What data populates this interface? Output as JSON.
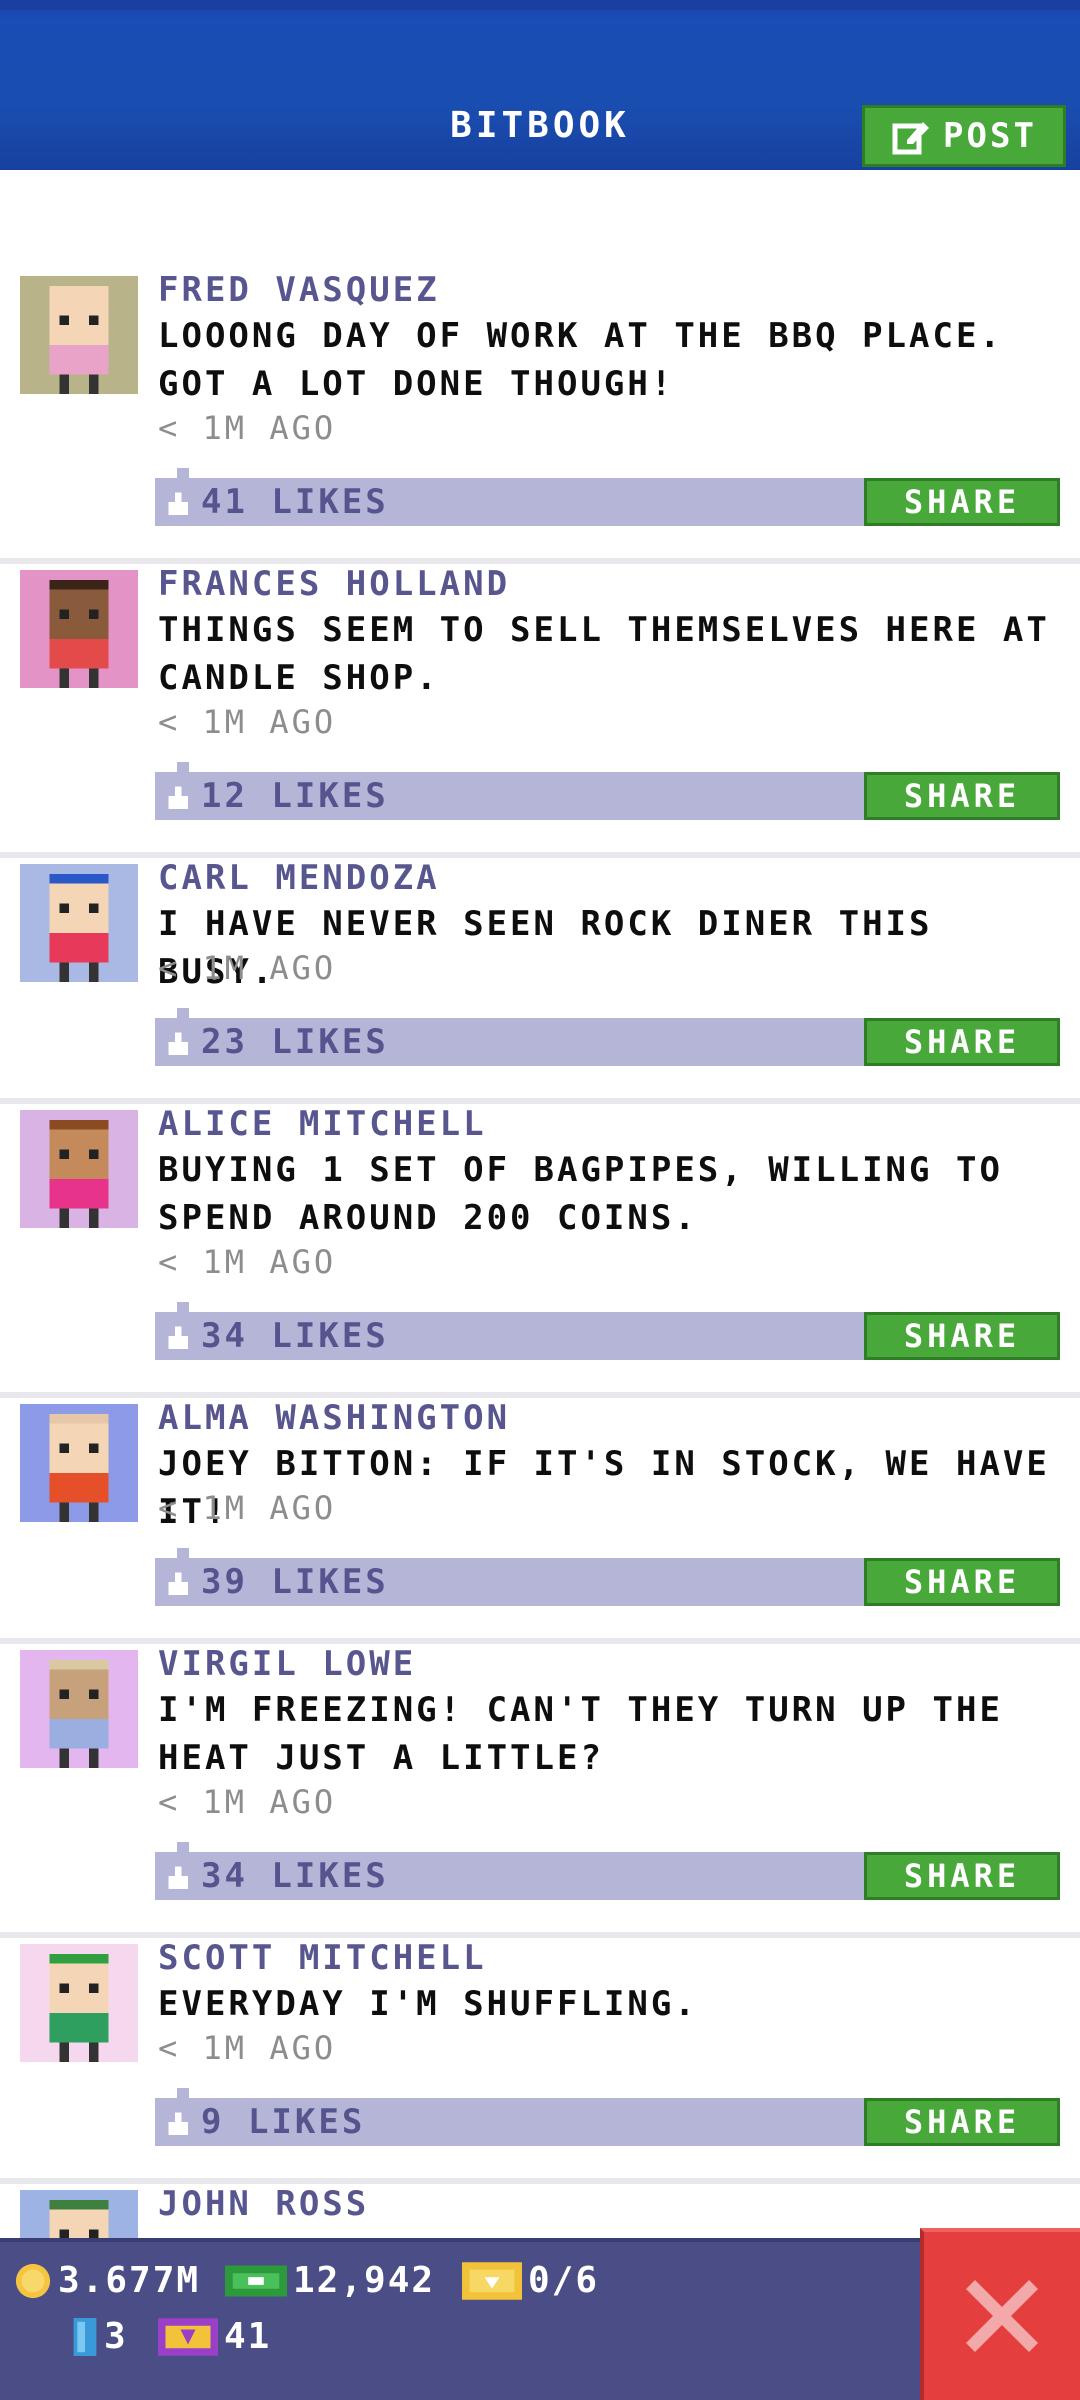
{
  "header": {
    "title": "BITBOOK",
    "post_label": "POST"
  },
  "posts": [
    {
      "name": "FRED VASQUEZ",
      "message": "LOOONG DAY OF WORK AT THE BBQ PLACE. GOT A LOT DONE THOUGH!",
      "time": "< 1M AGO",
      "likes": "41 LIKES",
      "share": "SHARE",
      "avatar_bg": "#b9b389",
      "shirt": "#e9a3c9",
      "skin": "#f4d5b5",
      "hair": "#f4d5b5"
    },
    {
      "name": "FRANCES HOLLAND",
      "message": "THINGS SEEM TO SELL THEMSELVES HERE AT CANDLE SHOP.",
      "time": "< 1M AGO",
      "likes": "12 LIKES",
      "share": "SHARE",
      "avatar_bg": "#e493c7",
      "shirt": "#e34a4a",
      "skin": "#8a5a3c",
      "hair": "#3a2518"
    },
    {
      "name": "CARL MENDOZA",
      "message": "I HAVE NEVER SEEN ROCK DINER THIS BUSY.",
      "time": "< 1M AGO",
      "likes": "23 LIKES",
      "share": "SHARE",
      "avatar_bg": "#a9b9e3",
      "shirt": "#e73a5a",
      "skin": "#f4d5b5",
      "hair": "#2a58c9"
    },
    {
      "name": "ALICE MITCHELL",
      "message": "BUYING 1 SET OF BAGPIPES, WILLING TO SPEND AROUND 200 COINS.",
      "time": "< 1M AGO",
      "likes": "34 LIKES",
      "share": "SHARE",
      "avatar_bg": "#d9b3e3",
      "shirt": "#e8338a",
      "skin": "#c48a5c",
      "hair": "#8a4a22"
    },
    {
      "name": "ALMA WASHINGTON",
      "message": "JOEY BITTON: IF IT'S IN STOCK, WE HAVE IT!",
      "time": "< 1M AGO",
      "likes": "39 LIKES",
      "share": "SHARE",
      "avatar_bg": "#8d9ae8",
      "shirt": "#e5502a",
      "skin": "#f4d5b5",
      "hair": "#e6c7a8"
    },
    {
      "name": "VIRGIL LOWE",
      "message": "I'M FREEZING! CAN'T THEY TURN UP THE HEAT JUST A LITTLE?",
      "time": "< 1M AGO",
      "likes": "34 LIKES",
      "share": "SHARE",
      "avatar_bg": "#e3b6f0",
      "shirt": "#9aaee0",
      "skin": "#c7a07c",
      "hair": "#d8c9a0"
    },
    {
      "name": "SCOTT MITCHELL",
      "message": "EVERYDAY I'M SHUFFLING.",
      "time": "< 1M AGO",
      "likes": "9 LIKES",
      "share": "SHARE",
      "avatar_bg": "#f5d7ee",
      "shirt": "#2f9f5f",
      "skin": "#f4d5b5",
      "hair": "#2f9f3f"
    },
    {
      "name": "JOHN ROSS",
      "message": "",
      "time": "",
      "likes": "",
      "share": "",
      "avatar_bg": "#9db3e3",
      "shirt": "#3a7a3a",
      "skin": "#f4d5b5",
      "hair": "#3f7f3f"
    }
  ],
  "bottom_bar": {
    "coins": "3.677M",
    "bux": "12,942",
    "tickets": "0/6",
    "gems": "3",
    "vip": "41"
  },
  "colors": {
    "header_blue": "#1a4db0",
    "green_button": "#49a83a",
    "like_bar": "#b5b6d7",
    "name_purple": "#58568f",
    "bottom_bar": "#4a4d86",
    "close_red": "#e43e3e"
  },
  "icons": {
    "post": "edit-icon",
    "like": "thumb-icon",
    "close": "close-icon",
    "coin": "coin-icon",
    "bux": "bux-icon",
    "ticket": "ticket-icon",
    "gem": "gem-icon",
    "vip": "vip-icon"
  }
}
